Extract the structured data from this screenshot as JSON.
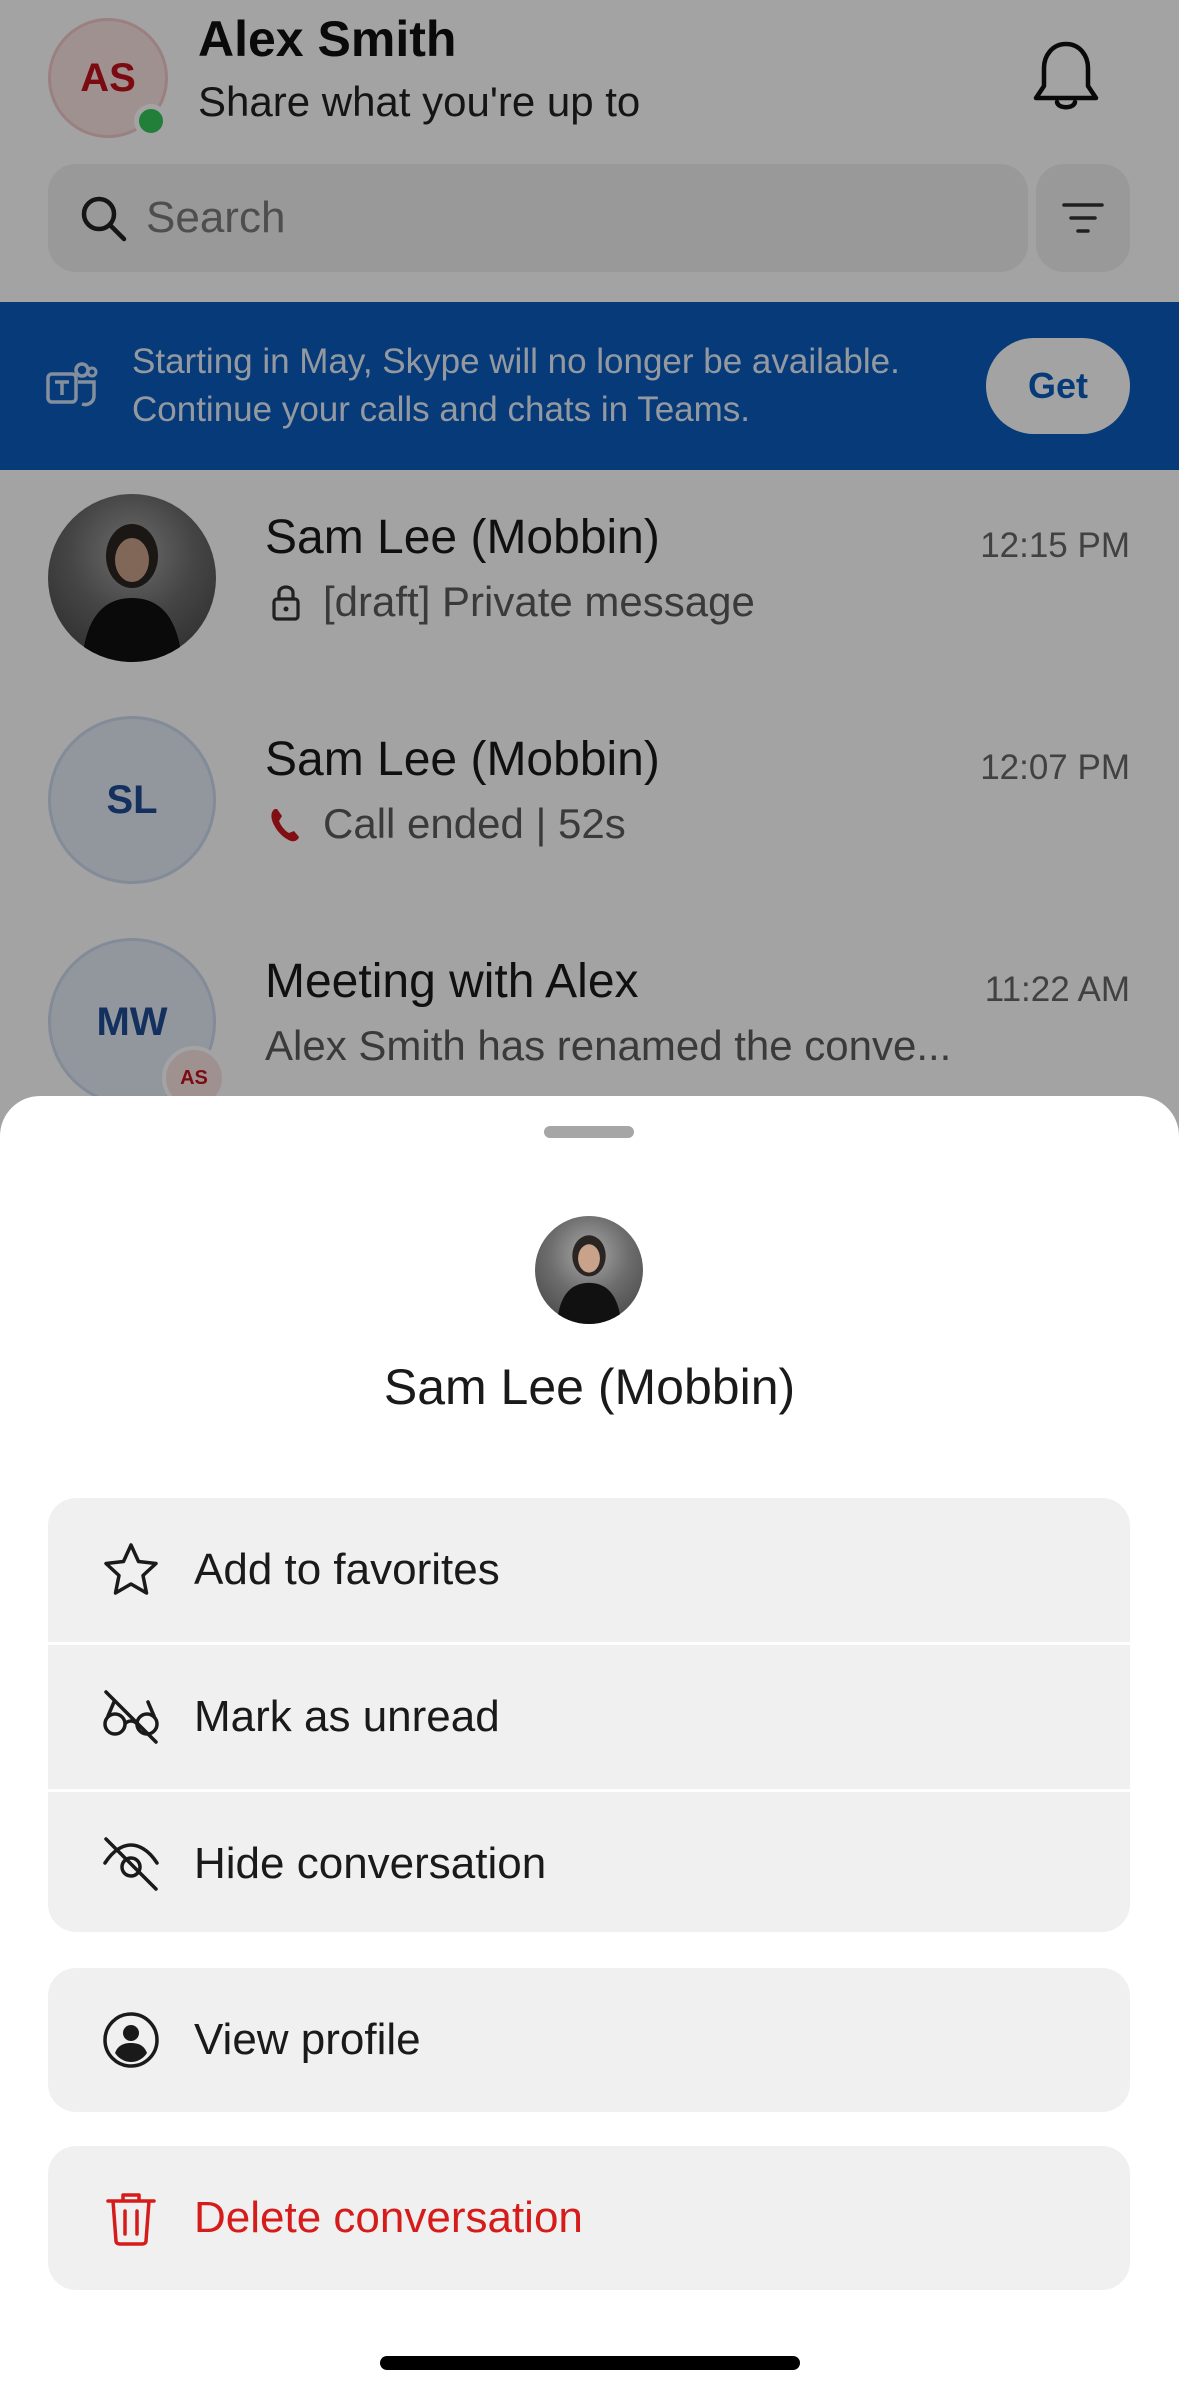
{
  "header": {
    "avatar_initials": "AS",
    "user_name": "Alex Smith",
    "status_prompt": "Share what you're up to",
    "search_placeholder": "Search"
  },
  "banner": {
    "line1": "Starting in May, Skype will no longer be available.",
    "line2": "Continue your calls and chats in Teams.",
    "button_label": "Get"
  },
  "conversations": [
    {
      "name": "Sam Lee (Mobbin)",
      "time": "12:15 PM",
      "preview": "[draft] Private message",
      "preview_icon": "lock-icon",
      "avatar": "photo"
    },
    {
      "name": "Sam Lee (Mobbin)",
      "time": "12:07 PM",
      "preview": "Call ended | 52s",
      "preview_icon": "phone-ended-icon",
      "avatar_initials": "SL"
    },
    {
      "name": "Meeting with Alex",
      "time": "11:22 AM",
      "preview": "Alex Smith has renamed the conve...",
      "avatar_initials": "MW",
      "badge_initials": "AS"
    }
  ],
  "sheet": {
    "contact_name": "Sam Lee (Mobbin)",
    "actions_group1": [
      {
        "label": "Add to favorites",
        "icon": "star-icon"
      },
      {
        "label": "Mark as unread",
        "icon": "glasses-off-icon"
      },
      {
        "label": "Hide conversation",
        "icon": "eye-off-icon"
      }
    ],
    "view_profile": {
      "label": "View profile",
      "icon": "person-circle-icon"
    },
    "delete": {
      "label": "Delete conversation",
      "icon": "trash-icon",
      "color": "#d61b1b"
    }
  },
  "colors": {
    "banner_bg": "#0b5cbd",
    "danger": "#d61b1b",
    "presence": "#34c759"
  }
}
